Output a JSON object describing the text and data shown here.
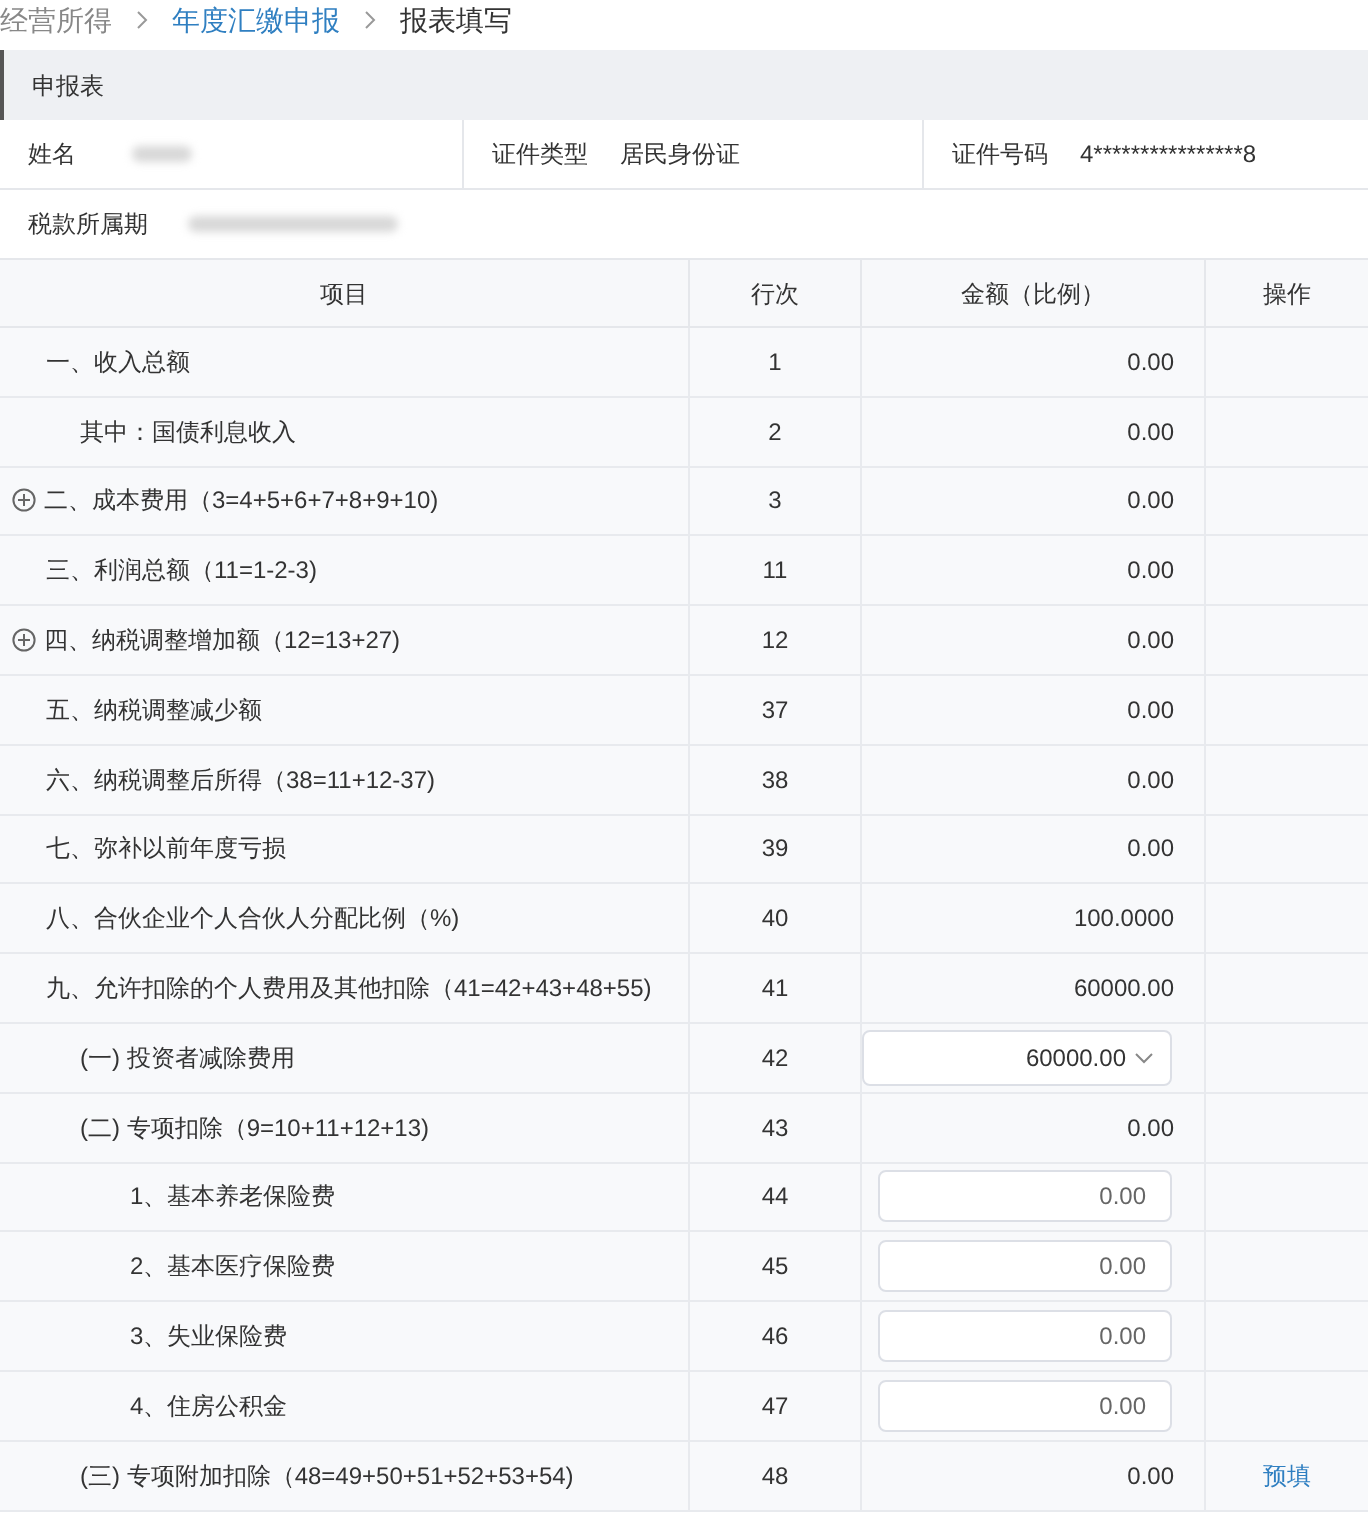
{
  "breadcrumb": [
    {
      "label": "经营所得",
      "kind": "muted"
    },
    {
      "label": "年度汇缴申报",
      "kind": "link"
    },
    {
      "label": "报表填写",
      "kind": "current"
    }
  ],
  "panel": {
    "title": "申报表"
  },
  "info": {
    "name_label": "姓名",
    "id_type_label": "证件类型",
    "id_type": "居民身份证",
    "id_number_label": "证件号码",
    "id_number": "4****************8",
    "period_label": "税款所属期"
  },
  "table": {
    "columns": [
      "项目",
      "行次",
      "金额（比例）",
      "操作"
    ],
    "rows": [
      {
        "item": "一、收入总额",
        "line": "1",
        "amount": "0.00",
        "kind": "text",
        "children": [
          {
            "item": "其中：国债利息收入",
            "line": "2",
            "amount": "0.00",
            "kind": "text"
          }
        ]
      },
      {
        "item": "二、成本费用（3=4+5+6+7+8+9+10)",
        "line": "3",
        "amount": "0.00",
        "kind": "text",
        "expanded": false
      },
      {
        "item": "三、利润总额（11=1-2-3)",
        "line": "11",
        "amount": "0.00",
        "kind": "text"
      },
      {
        "item": "四、纳税调整增加额（12=13+27)",
        "line": "12",
        "amount": "0.00",
        "kind": "text",
        "expanded": false
      },
      {
        "item": "五、纳税调整减少额",
        "line": "37",
        "amount": "0.00",
        "kind": "text"
      },
      {
        "item": "六、纳税调整后所得（38=11+12-37)",
        "line": "38",
        "amount": "0.00",
        "kind": "text"
      },
      {
        "item": "七、弥补以前年度亏损",
        "line": "39",
        "amount": "0.00",
        "kind": "text"
      },
      {
        "item": "八、合伙企业个人合伙人分配比例（%)",
        "line": "40",
        "amount": "100.0000",
        "kind": "text"
      },
      {
        "item": "九、允许扣除的个人费用及其他扣除（41=42+43+48+55)",
        "line": "41",
        "amount": "60000.00",
        "kind": "text",
        "children": [
          {
            "item": "(一) 投资者减除费用",
            "line": "42",
            "amount": "60000.00",
            "kind": "select"
          },
          {
            "item": "(二) 专项扣除（9=10+11+12+13)",
            "line": "43",
            "amount": "0.00",
            "kind": "text",
            "children": [
              {
                "item": "1、基本养老保险费",
                "line": "44",
                "amount": "0.00",
                "kind": "input"
              },
              {
                "item": "2、基本医疗保险费",
                "line": "45",
                "amount": "0.00",
                "kind": "input"
              },
              {
                "item": "3、失业保险费",
                "line": "46",
                "amount": "0.00",
                "kind": "input"
              },
              {
                "item": "4、住房公积金",
                "line": "47",
                "amount": "0.00",
                "kind": "input"
              }
            ]
          },
          {
            "item": "(三) 专项附加扣除（48=49+50+51+52+53+54)",
            "line": "48",
            "amount": "0.00",
            "kind": "text",
            "action": "预填"
          }
        ]
      }
    ]
  }
}
